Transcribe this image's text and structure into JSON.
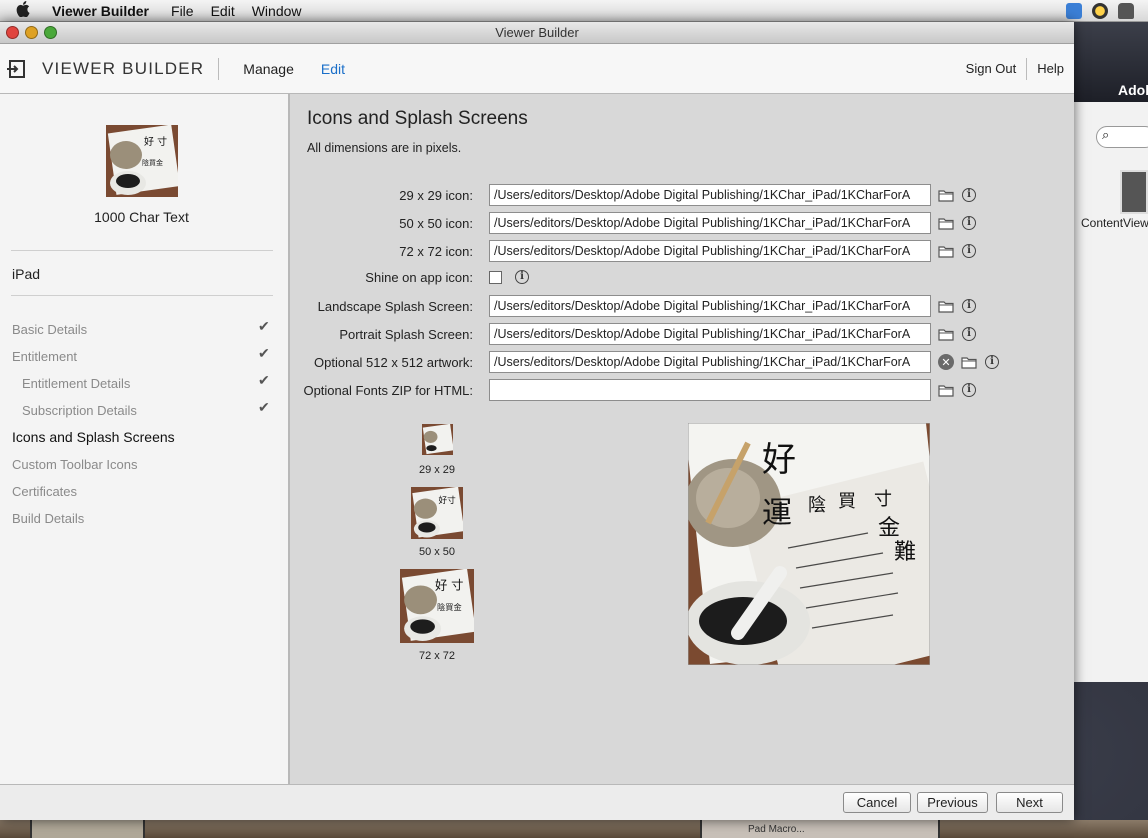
{
  "menubar": {
    "app_name": "Viewer Builder",
    "items": [
      "File",
      "Edit",
      "Window"
    ]
  },
  "background_window": {
    "title_fragment": "Adob",
    "file_label": "ContentView"
  },
  "window": {
    "title": "Viewer Builder"
  },
  "toolbar": {
    "brand": "VIEWER BUILDER",
    "nav_manage": "Manage",
    "nav_edit": "Edit",
    "sign_out": "Sign Out",
    "help": "Help",
    "accent_color": "#1a6fc9"
  },
  "sidebar": {
    "viewer_name": "1000 Char Text",
    "device": "iPad",
    "items": [
      {
        "label": "Basic Details",
        "checked": true
      },
      {
        "label": "Entitlement",
        "checked": true
      },
      {
        "label": "Entitlement Details",
        "checked": true
      },
      {
        "label": "Subscription Details",
        "checked": true
      },
      {
        "label": "Icons and Splash Screens",
        "checked": false
      },
      {
        "label": "Custom Toolbar Icons",
        "checked": false
      },
      {
        "label": "Certificates",
        "checked": false
      },
      {
        "label": "Build Details",
        "checked": false
      }
    ]
  },
  "content": {
    "title": "Icons and Splash Screens",
    "subtitle": "All dimensions are in pixels.",
    "fields": [
      {
        "label": "29 x 29 icon:",
        "value": "/Users/editors/Desktop/Adobe Digital Publishing/1KChar_iPad/1KCharForA"
      },
      {
        "label": "50 x 50 icon:",
        "value": "/Users/editors/Desktop/Adobe Digital Publishing/1KChar_iPad/1KCharForA"
      },
      {
        "label": "72 x 72 icon:",
        "value": "/Users/editors/Desktop/Adobe Digital Publishing/1KChar_iPad/1KCharForA"
      },
      {
        "label": "Shine on app icon:",
        "value": ""
      },
      {
        "label": "Landscape Splash Screen:",
        "value": "/Users/editors/Desktop/Adobe Digital Publishing/1KChar_iPad/1KCharForA"
      },
      {
        "label": "Portrait Splash Screen:",
        "value": "/Users/editors/Desktop/Adobe Digital Publishing/1KChar_iPad/1KCharForA"
      },
      {
        "label": "Optional 512 x 512 artwork:",
        "value": "/Users/editors/Desktop/Adobe Digital Publishing/1KChar_iPad/1KCharForA"
      },
      {
        "label": "Optional Fonts ZIP for HTML:",
        "value": ""
      }
    ],
    "shine_checked": false,
    "previews": [
      "29 x 29",
      "50 x 50",
      "72 x 72"
    ],
    "artwork_chars": [
      "好",
      "運",
      "陰",
      "買",
      "寸",
      "金",
      "難"
    ]
  },
  "footer": {
    "cancel": "Cancel",
    "previous": "Previous",
    "next": "Next"
  },
  "desktop": {
    "peek_text": "Pad Macro..."
  }
}
